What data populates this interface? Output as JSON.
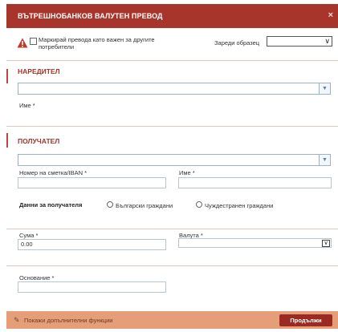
{
  "window": {
    "title": "ВЪТРЕШНОБАНКОВ ВАЛУТЕН ПРЕВОД",
    "close_glyph": "×"
  },
  "top": {
    "mark_label": "Маркирай превода като важен за другите потребители",
    "template_label": "Зареди образец",
    "template_value": "",
    "template_arrow": "∨",
    "warning_icon": "warning-triangle-icon"
  },
  "sender": {
    "title": "НАРЕДИТЕЛ",
    "name_label": "Име *",
    "combo_arrow": "▼"
  },
  "recipient": {
    "title": "ПОЛУЧАТЕЛ",
    "combo_arrow": "▼",
    "account_label": "Номер на сметка/IBAN *",
    "name_label": "Име *",
    "data_label": "Данни за получателя",
    "radio_bg": "Български граждани",
    "radio_foreign": "Чуждестранен граждани"
  },
  "amount": {
    "amount_label": "Сума *",
    "amount_value": "0.00",
    "currency_label": "Валута *",
    "currency_value": "",
    "currency_arrow": "∨"
  },
  "basis": {
    "label": "Основание *",
    "value": ""
  },
  "footer": {
    "more_label": "Покажи допълнителни функции",
    "continue_label": "Продължи"
  },
  "colors": {
    "title_bar": "#a8352b",
    "section_title": "#a3342a",
    "footer": "#e59e78",
    "continue_button": "#9b2a22"
  }
}
